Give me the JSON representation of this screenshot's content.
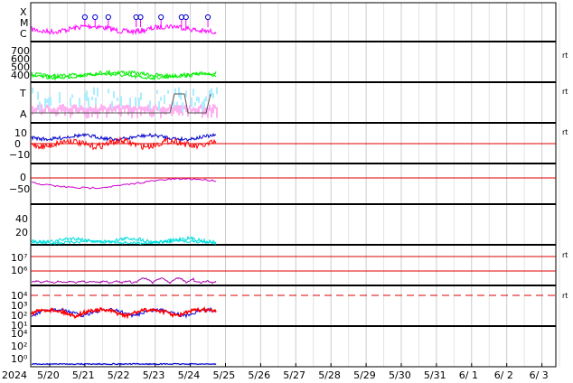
{
  "chart_data": {
    "type": "line",
    "x_axis": {
      "year_label": "2024",
      "ticks": [
        "5/20",
        "5/21",
        "5/22",
        "5/23",
        "5/24",
        "5/25",
        "5/26",
        "5/27",
        "5/28",
        "5/29",
        "5/30",
        "5/31",
        "6/ 1",
        "6/ 2",
        "6/ 3"
      ],
      "range": [
        "2024-05-19",
        "2024-06-04"
      ],
      "data_end": "2024-05-24T18:00"
    },
    "panels": [
      {
        "id": "flare-class",
        "y_labels": [
          "X",
          "M",
          "C"
        ],
        "marker": "",
        "series": [
          {
            "color": "#ff00ff",
            "level": "C",
            "range": [
              0.15,
              0.6
            ]
          }
        ],
        "events": [
          {
            "x": "2024-05-21T00:00"
          },
          {
            "x": "2024-05-21T07:00"
          },
          {
            "x": "2024-05-21T16:00"
          },
          {
            "x": "2024-05-22T11:00"
          },
          {
            "x": "2024-05-22T14:00"
          },
          {
            "x": "2024-05-23T04:00"
          },
          {
            "x": "2024-05-23T18:00"
          },
          {
            "x": "2024-05-23T21:00"
          },
          {
            "x": "2024-05-24T12:00"
          }
        ]
      },
      {
        "id": "solar-wind-speed",
        "y_ticks": [
          "700",
          "600",
          "500",
          "400"
        ],
        "marker": "rt",
        "series": [
          {
            "color": "#00ee00",
            "range": [
              380,
              450
            ]
          }
        ]
      },
      {
        "id": "ta-level",
        "y_labels": [
          "T",
          "A"
        ],
        "marker": "rt",
        "series": [
          {
            "color": "#ffb0f0",
            "band": "A"
          },
          {
            "color": "#aaeeff",
            "band": "T"
          },
          {
            "color": "#555555",
            "band": "step"
          }
        ]
      },
      {
        "id": "imf-components",
        "y_ticks": [
          "10",
          "0",
          "−10"
        ],
        "marker": "rt",
        "series": [
          {
            "color": "#0000cc",
            "range": [
              2,
              8
            ]
          },
          {
            "color": "#ff0000",
            "range": [
              -6,
              2
            ]
          }
        ],
        "ref_line": 0
      },
      {
        "id": "dst-index",
        "y_ticks": [
          "0",
          "−50"
        ],
        "marker": "",
        "series": [
          {
            "color": "#cc00cc",
            "range": [
              -50,
              0
            ]
          }
        ],
        "ref_line": 0
      },
      {
        "id": "density",
        "y_ticks": [
          "40",
          "20"
        ],
        "marker": "",
        "series": [
          {
            "color": "#00dddd",
            "range": [
              3,
              12
            ]
          }
        ]
      },
      {
        "id": "electron-flux",
        "y_ticks": [
          "10⁷",
          "10⁶"
        ],
        "marker": "rt",
        "series": [
          {
            "color": "#aa00aa",
            "range": [
              100000.0,
              500000.0
            ]
          }
        ],
        "ref_lines": [
          "10⁷",
          "10⁶"
        ]
      },
      {
        "id": "proton-flux",
        "y_ticks": [
          "10⁴",
          "10³",
          "10²",
          "10¹"
        ],
        "marker": "rt",
        "series": [
          {
            "color": "#0000dd",
            "range": [
              10,
              200
            ]
          },
          {
            "color": "#ff0000",
            "range": [
              5,
              150
            ]
          }
        ],
        "dashed_line": "10⁴"
      },
      {
        "id": "xray-flux",
        "y_ticks": [
          "10⁴",
          "10²",
          "10⁰"
        ],
        "marker": "",
        "series": [
          {
            "color": "#0000cc",
            "range": [
              0.5,
              1
            ]
          }
        ]
      }
    ],
    "colors": {
      "ref": "#dd0000",
      "grid": "#cccccc",
      "frame": "#000000"
    },
    "grid": true,
    "legend": "none"
  }
}
